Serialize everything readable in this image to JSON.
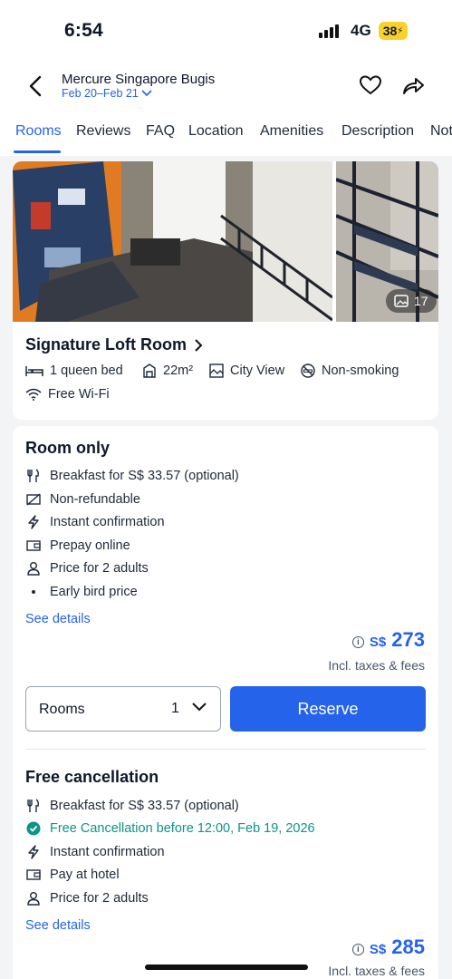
{
  "status_bar": {
    "time": "6:54",
    "network": "4G",
    "battery": "38"
  },
  "header": {
    "hotel_name": "Mercure Singapore Bugis",
    "dates": "Feb 20–Feb 21",
    "icons": [
      "back-arrow-icon",
      "heart-icon",
      "share-icon"
    ]
  },
  "tabs": [
    {
      "label": "Rooms",
      "active": true
    },
    {
      "label": "Reviews"
    },
    {
      "label": "FAQ"
    },
    {
      "label": "Location"
    },
    {
      "label": "Amenities"
    },
    {
      "label": "Description"
    },
    {
      "label": "Not"
    }
  ],
  "room": {
    "photo_count": "17",
    "title": "Signature Loft Room",
    "amenities": {
      "bed": "1 queen bed",
      "size": "22m²",
      "view": "City View",
      "smoking": "Non-smoking",
      "wifi": "Free Wi-Fi"
    }
  },
  "rate1": {
    "title": "Room only",
    "features": [
      "Breakfast for S$ 33.57 (optional)",
      "Non-refundable",
      "Instant confirmation",
      "Prepay online",
      "Price for 2 adults",
      "Early bird price"
    ],
    "see_details": "See details",
    "currency": "S$",
    "price": "273",
    "incl": "Incl. taxes & fees"
  },
  "booking": {
    "rooms_label": "Rooms",
    "rooms_qty": "1",
    "reserve_label": "Reserve"
  },
  "rate2": {
    "title": "Free cancellation",
    "features": [
      "Breakfast for S$ 33.57 (optional)",
      "Free Cancellation before 12:00, Feb 19, 2026",
      "Instant confirmation",
      "Pay at hotel",
      "Price for 2 adults"
    ],
    "see_details": "See details",
    "currency": "S$",
    "price": "285",
    "incl": "Incl. taxes & fees"
  },
  "colors": {
    "accent": "#2563eb",
    "green": "#0d9488",
    "battery": "#f8d22b"
  }
}
